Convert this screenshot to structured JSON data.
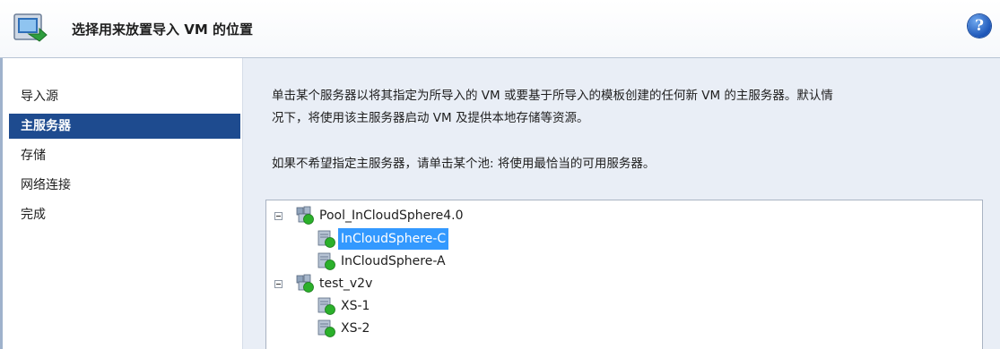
{
  "header": {
    "title": "选择用来放置导入 VM 的位置",
    "help": "?",
    "icon": "import-wizard-icon"
  },
  "sidebar": {
    "items": [
      {
        "label": "导入源",
        "active": false
      },
      {
        "label": "主服务器",
        "active": true
      },
      {
        "label": "存储",
        "active": false
      },
      {
        "label": "网络连接",
        "active": false
      },
      {
        "label": "完成",
        "active": false
      }
    ]
  },
  "main": {
    "description_line1": "单击某个服务器以将其指定为所导入的 VM 或要基于所导入的模板创建的任何新 VM 的主服务器。默认情",
    "description_line2": "况下，将使用该主服务器启动 VM 及提供本地存储等资源。",
    "hint": "如果不希望指定主服务器，请单击某个池: 将使用最恰当的可用服务器。"
  },
  "tree": {
    "pools": [
      {
        "label": "Pool_InCloudSphere4.0",
        "servers": [
          {
            "label": "InCloudSphere-C",
            "selected": true
          },
          {
            "label": "InCloudSphere-A",
            "selected": false
          }
        ]
      },
      {
        "label": "test_v2v",
        "servers": [
          {
            "label": "XS-1",
            "selected": false
          },
          {
            "label": "XS-2",
            "selected": false
          }
        ]
      }
    ]
  },
  "colors": {
    "accent_nav": "#1e4b8f",
    "selection": "#3399ff",
    "panel_bg": "#e9eef6",
    "status_green": "#2bb02b"
  }
}
